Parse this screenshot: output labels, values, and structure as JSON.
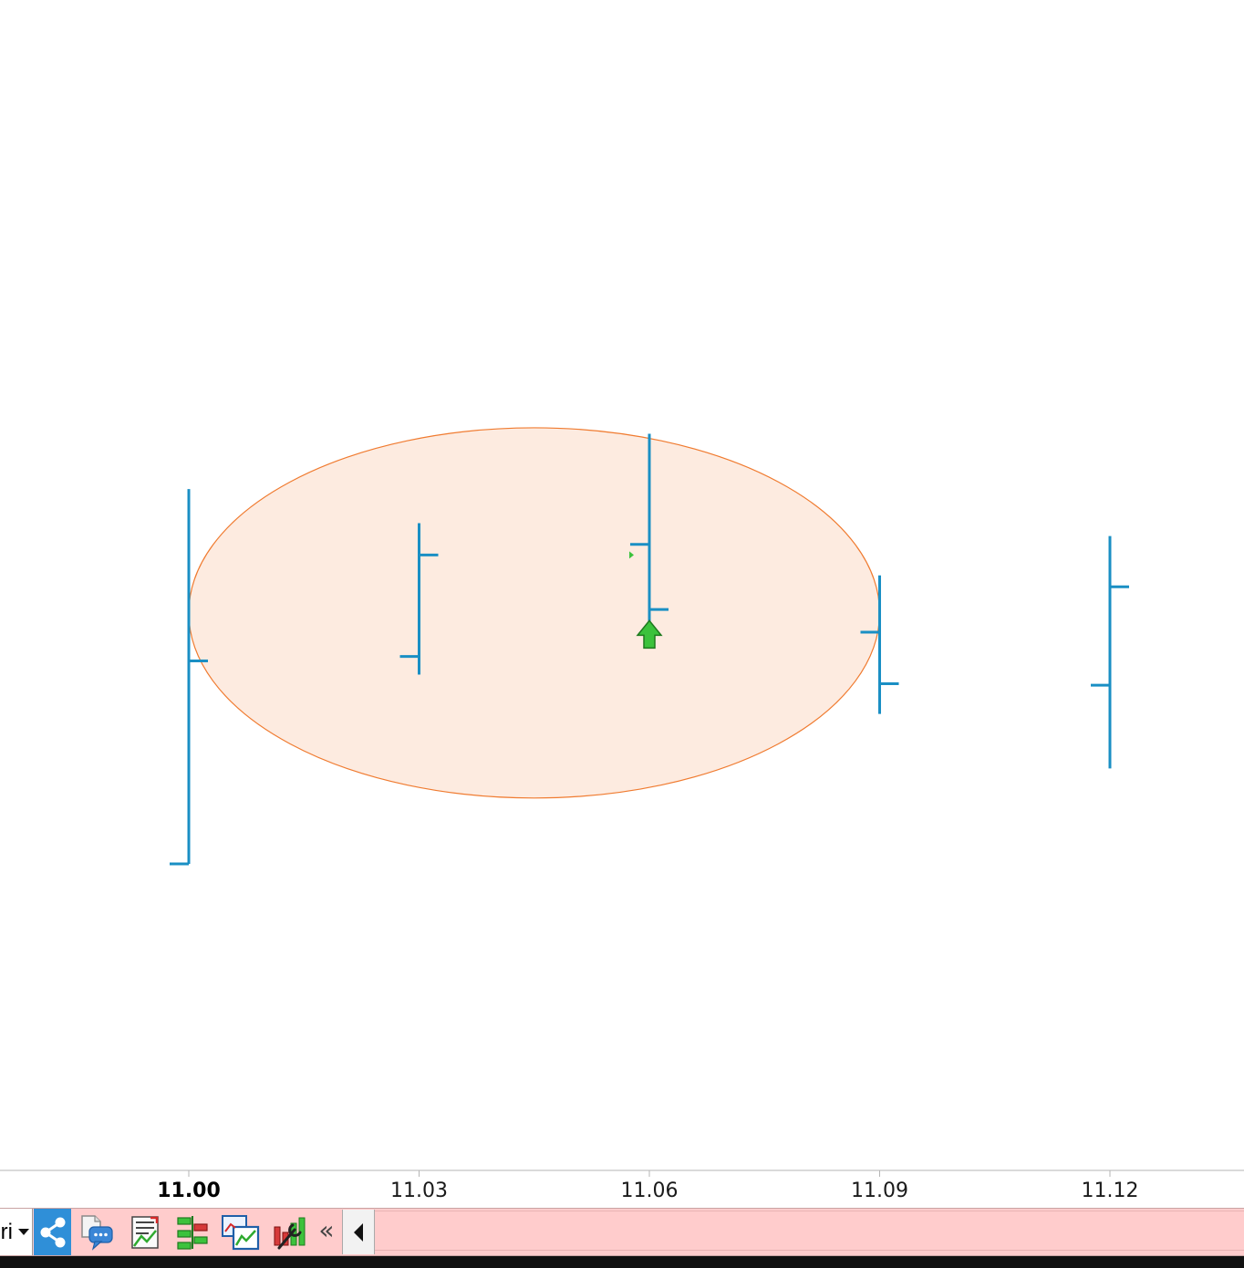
{
  "chart_data": {
    "type": "ohlc",
    "title": "",
    "xlabel": "",
    "ylabel": "",
    "x": [
      "11.00",
      "11.03",
      "11.06",
      "11.09",
      "11.12"
    ],
    "bold_tick": "11.00",
    "y_range": [
      0,
      1000
    ],
    "bars": [
      {
        "x": "11.00",
        "open": 100,
        "high": 595,
        "low": 100,
        "close": 368
      },
      {
        "x": "11.03",
        "open": 374,
        "high": 550,
        "low": 350,
        "close": 508
      },
      {
        "x": "11.06",
        "open": 522,
        "high": 668,
        "low": 416,
        "close": 436
      },
      {
        "x": "11.09",
        "open": 406,
        "high": 481,
        "low": 298,
        "close": 338
      },
      {
        "x": "11.12",
        "open": 336,
        "high": 533,
        "low": 226,
        "close": 466
      }
    ],
    "series_color": "#1a8fc4",
    "annotations": [
      {
        "type": "ellipse",
        "x_from": "11.00",
        "x_to": "11.09",
        "y_from": 187,
        "y_to": 676,
        "fill": "#fdebe0",
        "stroke": "#f07b30"
      },
      {
        "type": "arrow-up",
        "x": "11.06",
        "y": 402,
        "color": "#3cc23c"
      },
      {
        "type": "small-marker",
        "x": "11.06",
        "y": 508,
        "color": "#3cc23c"
      }
    ],
    "grid": false,
    "legend": "none"
  },
  "toolbar": {
    "series_selector_text": "ri",
    "icons": [
      "share-icon",
      "chat-document-icon",
      "report-icon",
      "tree-icon",
      "compare-charts-icon",
      "tools-icon"
    ],
    "collapse_label": "«",
    "background": "#ffcccc"
  }
}
